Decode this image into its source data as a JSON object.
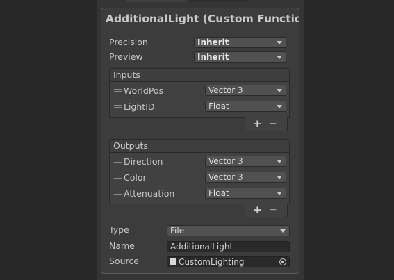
{
  "node": {
    "title": "AdditionalLight (Custom Function) Node"
  },
  "precision": {
    "label": "Precision",
    "value": "Inherit"
  },
  "preview": {
    "label": "Preview",
    "value": "Inherit"
  },
  "inputs": {
    "header": "Inputs",
    "items": [
      {
        "name": "WorldPos",
        "type": "Vector 3"
      },
      {
        "name": "LightID",
        "type": "Float"
      }
    ]
  },
  "outputs": {
    "header": "Outputs",
    "items": [
      {
        "name": "Direction",
        "type": "Vector 3"
      },
      {
        "name": "Color",
        "type": "Vector 3"
      },
      {
        "name": "Attenuation",
        "type": "Float"
      }
    ]
  },
  "list_controls": {
    "add": "+",
    "remove": "−"
  },
  "type": {
    "label": "Type",
    "value": "File"
  },
  "name": {
    "label": "Name",
    "value": "AdditionalLight"
  },
  "source": {
    "label": "Source",
    "value": "CustomLighting",
    "icon": "file-icon",
    "picker_icon": "object-picker-icon"
  }
}
